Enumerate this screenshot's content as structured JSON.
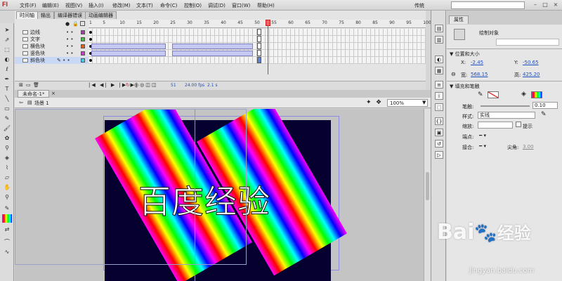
{
  "app": {
    "logo_text": "Fl"
  },
  "menu": [
    "文件(F)",
    "编辑(E)",
    "视图(V)",
    "插入(I)",
    "修改(M)",
    "文本(T)",
    "命令(C)",
    "控制(O)",
    "调试(D)",
    "窗口(W)",
    "帮助(H)"
  ],
  "workspace_preset": "传统",
  "timeline": {
    "tabs": [
      "时间轴",
      "输出",
      "编译器错误",
      "动画编辑器"
    ],
    "ruler": [
      "1",
      "5",
      "10",
      "15",
      "20",
      "25",
      "30",
      "35",
      "40",
      "45",
      "50",
      "55",
      "60",
      "65",
      "70",
      "75",
      "80",
      "85",
      "90",
      "95",
      "100"
    ],
    "layers": [
      {
        "name": "边线",
        "color": "#a040a0"
      },
      {
        "name": "文字",
        "color": "#40c040"
      },
      {
        "name": "横色块",
        "color": "#e06020"
      },
      {
        "name": "竖色块",
        "color": "#c040c0"
      },
      {
        "name": "斜色块",
        "color": "#40d0e0",
        "selected": true
      }
    ],
    "current_frame": "51",
    "fps": "24.00 fps",
    "time": "2.1 s"
  },
  "document": {
    "tab": "未命名-1*",
    "scene": "场景 1",
    "zoom": "100%",
    "stage_text": "百度经验"
  },
  "properties": {
    "tab": "属性",
    "object_type": "绘制对象",
    "position_section": "位置和大小",
    "x_label": "X:",
    "x_value": "-2.45",
    "y_label": "Y:",
    "y_value": "-50.65",
    "w_label": "宽:",
    "w_value": "568.15",
    "h_label": "高:",
    "h_value": "425.20",
    "fill_section": "填充和笔触",
    "stroke_label": "笔触:",
    "stroke_value": "0.10",
    "style_label": "样式:",
    "style_value": "实线",
    "scale_label": "缩放:",
    "hint_label": "提示",
    "cap_label": "端点:",
    "join_label": "接合:",
    "miter_label": "尖角:",
    "miter_value": "3.00"
  },
  "watermark": {
    "logo": "Bai",
    "logo_cn": "经验",
    "url": "jingyan.baidu.com"
  },
  "colors": {
    "stage": "#060030",
    "accent": "#2050c0",
    "playhead": "#e03030"
  }
}
